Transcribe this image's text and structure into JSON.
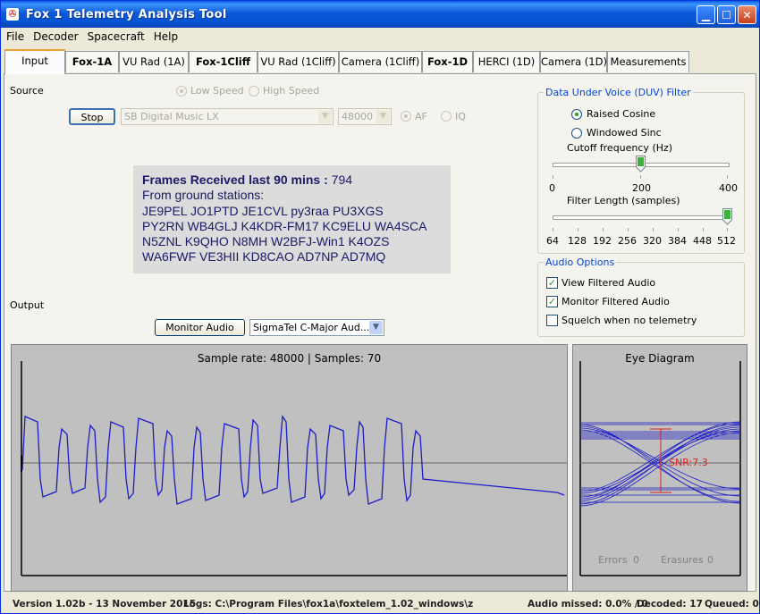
{
  "window": {
    "title": "Fox 1 Telemetry Analysis Tool"
  },
  "menu": [
    "File",
    "Decoder",
    "Spacecraft",
    "Help"
  ],
  "tabs": [
    {
      "label": "Input",
      "bold": false,
      "active": true
    },
    {
      "label": "Fox-1A",
      "bold": true
    },
    {
      "label": "VU Rad (1A)",
      "bold": false
    },
    {
      "label": "Fox-1Cliff",
      "bold": true
    },
    {
      "label": "VU Rad (1Cliff)",
      "bold": false
    },
    {
      "label": "Camera (1Cliff)",
      "bold": false
    },
    {
      "label": "Fox-1D",
      "bold": true
    },
    {
      "label": "HERCI (1D)",
      "bold": false
    },
    {
      "label": "Camera (1D)",
      "bold": false
    },
    {
      "label": "Measurements",
      "bold": false
    }
  ],
  "source": {
    "label": "Source",
    "low_speed": "Low Speed",
    "high_speed": "High Speed",
    "stop_button": "Stop",
    "device": "SB Digital Music LX",
    "rate": "48000",
    "af": "AF",
    "iq": "IQ"
  },
  "frames": {
    "header": "Frames Received last 90 mins : ",
    "count": "794",
    "stations_label": "From ground stations:",
    "lines": [
      "JE9PEL JO1PTD JE1CVL py3raa PU3XGS",
      "PY2RN WB4GLJ K4KDR-FM17 KC9ELU WA4SCA",
      "N5ZNL K9QHO N8MH W2BFJ-Win1 K4OZS",
      "WA6FWF VE3HII KD8CAO AD7NP AD7MQ"
    ]
  },
  "output": {
    "label": "Output",
    "monitor_button": "Monitor Audio",
    "device": "SigmaTel C-Major Aud..."
  },
  "filter": {
    "title": "Data Under Voice (DUV) Filter",
    "raised_cosine": "Raised Cosine",
    "windowed_sinc": "Windowed Sinc",
    "cutoff_label": "Cutoff frequency (Hz)",
    "cutoff_ticks": [
      "0",
      "200",
      "400"
    ],
    "cutoff_value": 200,
    "cutoff_max": 400,
    "length_label": "Filter Length (samples)",
    "length_ticks": [
      "64",
      "128",
      "192",
      "256",
      "320",
      "384",
      "448",
      "512"
    ],
    "length_value": 512
  },
  "audio_options": {
    "title": "Audio Options",
    "items": [
      {
        "label": "View Filtered Audio",
        "checked": true
      },
      {
        "label": "Monitor Filtered Audio",
        "checked": true
      },
      {
        "label": "Squelch when no telemetry",
        "checked": false
      }
    ]
  },
  "scope": {
    "title": "Sample rate: 48000 | Samples: 70"
  },
  "eye": {
    "title": "Eye Diagram",
    "snr": "SNR:7.3",
    "errors_label": "Errors",
    "errors": "0",
    "erasures_label": "Erasures",
    "erasures": "0"
  },
  "status": {
    "version": "Version 1.02b - 13 November 2015",
    "logs": "Logs: C:\\Program Files\\fox1a\\foxtelem_1.02_windows\\z",
    "audio_missed": "Audio missed: 0.0% / 0",
    "decoded": "Decoded: 17",
    "queued": "Queued: 0"
  },
  "colors": {
    "trace": "#1c1cc8",
    "snr_marker": "#e02020",
    "title_bar": "#0c59d6"
  }
}
